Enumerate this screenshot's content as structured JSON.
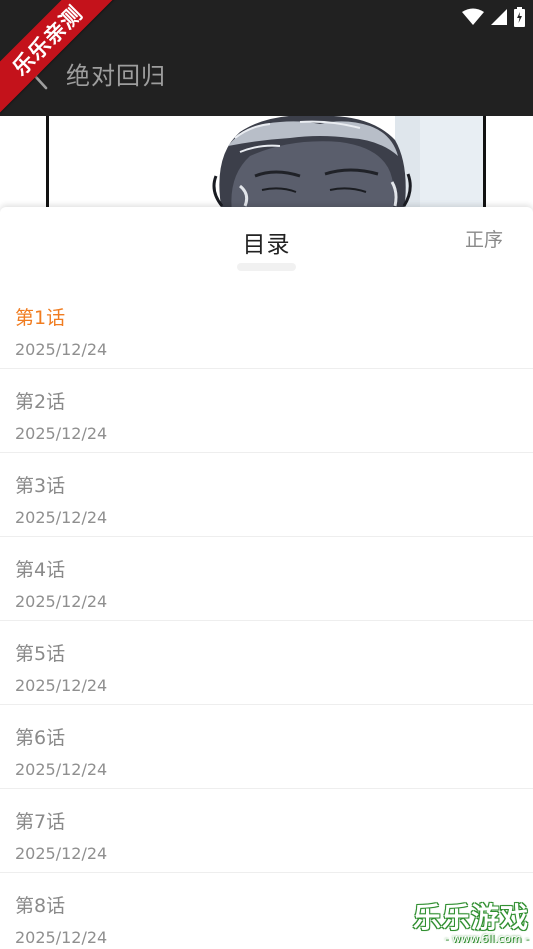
{
  "watermark_ribbon": "乐乐亲测",
  "header": {
    "title": "绝对回归"
  },
  "sheet": {
    "title": "目录",
    "sort_label": "正序"
  },
  "chapters": [
    {
      "name": "第1话",
      "date": "2025/12/24",
      "active": true
    },
    {
      "name": "第2话",
      "date": "2025/12/24"
    },
    {
      "name": "第3话",
      "date": "2025/12/24"
    },
    {
      "name": "第4话",
      "date": "2025/12/24"
    },
    {
      "name": "第5话",
      "date": "2025/12/24"
    },
    {
      "name": "第6话",
      "date": "2025/12/24"
    },
    {
      "name": "第7话",
      "date": "2025/12/24"
    },
    {
      "name": "第8话",
      "date": "2025/12/24"
    }
  ],
  "watermark_corner": {
    "main": "乐乐游戏",
    "url": "- www.6ll.com -"
  },
  "colors": {
    "topbar": "#212121",
    "active_chapter": "#f07c20",
    "ribbon": "#c4121b"
  }
}
